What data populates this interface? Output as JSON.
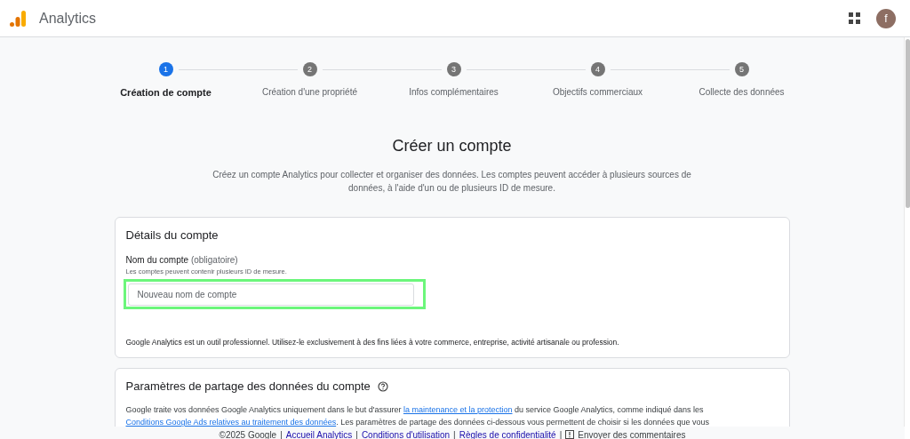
{
  "app": {
    "title": "Analytics",
    "avatar": "f"
  },
  "steps": [
    {
      "number": "1",
      "label": "Création de compte",
      "selected": true
    },
    {
      "number": "2",
      "label": "Création d'une propriété",
      "selected": false
    },
    {
      "number": "3",
      "label": "Infos complémentaires",
      "selected": false
    },
    {
      "number": "4",
      "label": "Objectifs commerciaux",
      "selected": false
    },
    {
      "number": "5",
      "label": "Collecte des données",
      "selected": false
    }
  ],
  "heading": "Créer un compte",
  "intro": "Créez un compte Analytics pour collecter et organiser des données. Les comptes peuvent accéder à plusieurs sources de données, à l'aide d'un ou de plusieurs ID de mesure.",
  "account_details": {
    "title": "Détails du compte",
    "field_label": "Nom du compte",
    "field_required": "(obligatoire)",
    "field_hint": "Les comptes peuvent contenir plusieurs ID de mesure.",
    "placeholder": "Nouveau nom de compte",
    "highlighted": true,
    "note": "Google Analytics est un outil professionnel. Utilisez-le exclusivement à des fins liées à votre commerce, entreprise, activité artisanale ou profession."
  },
  "sharing": {
    "title": "Paramètres de partage des données du compte",
    "text": [
      {
        "kind": "text",
        "text": "Google traite vos données Google Analytics uniquement dans le but d'assurer "
      },
      {
        "kind": "link",
        "text": "la maintenance et la protection"
      },
      {
        "kind": "text",
        "text": " du service Google Analytics, comme indiqué dans les "
      },
      {
        "kind": "link",
        "text": "Conditions Google Ads relatives au traitement des données"
      },
      {
        "kind": "text",
        "text": ". Les paramètres de partage des données ci-dessous vous permettent de choisir si les données que vous"
      }
    ]
  },
  "footer": [
    {
      "kind": "text",
      "text": "©2025 Google"
    },
    {
      "kind": "separator",
      "text": "|"
    },
    {
      "kind": "link",
      "text": "Accueil Analytics"
    },
    {
      "kind": "separator",
      "text": "|"
    },
    {
      "kind": "link",
      "text": "Conditions d'utilisation"
    },
    {
      "kind": "separator",
      "text": "|"
    },
    {
      "kind": "link",
      "text": "Règles de confidentialité"
    },
    {
      "kind": "separator",
      "text": "|"
    },
    {
      "kind": "feedback",
      "text": "Envoyer des commentaires"
    }
  ]
}
